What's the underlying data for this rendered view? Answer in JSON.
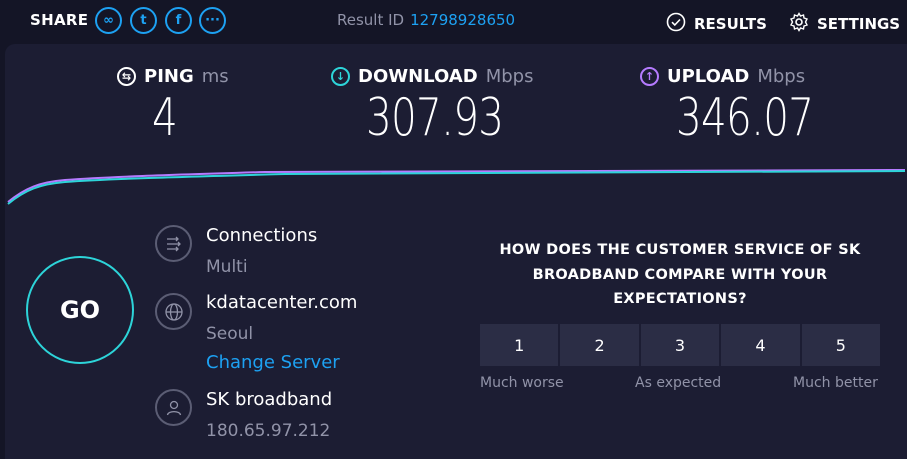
{
  "header": {
    "share_label": "SHARE",
    "share_icons": [
      "link-icon",
      "twitter-icon",
      "facebook-icon",
      "more-icon"
    ],
    "result_id_label": "Result ID",
    "result_id": "12798928650",
    "results_label": "RESULTS",
    "settings_label": "SETTINGS"
  },
  "metrics": {
    "ping": {
      "label": "PING",
      "unit": "ms",
      "value": "4"
    },
    "download": {
      "label": "DOWNLOAD",
      "unit": "Mbps",
      "value": "307.93"
    },
    "upload": {
      "label": "UPLOAD",
      "unit": "Mbps",
      "value": "346.07"
    }
  },
  "go_label": "GO",
  "connection": {
    "connections_title": "Connections",
    "connections_value": "Multi",
    "server_name": "kdatacenter.com",
    "server_location": "Seoul",
    "change_server_label": "Change Server",
    "isp_name": "SK broadband",
    "ip_address": "180.65.97.212"
  },
  "survey": {
    "question": "HOW DOES THE CUSTOMER SERVICE OF SK BROADBAND COMPARE WITH YOUR EXPECTATIONS?",
    "ratings": [
      "1",
      "2",
      "3",
      "4",
      "5"
    ],
    "low_label": "Much worse",
    "mid_label": "As expected",
    "high_label": "Much better"
  },
  "colors": {
    "accent": "#1da1f2",
    "download": "#2dd4d9",
    "upload": "#b57bff",
    "panel": "#1c1d33"
  }
}
